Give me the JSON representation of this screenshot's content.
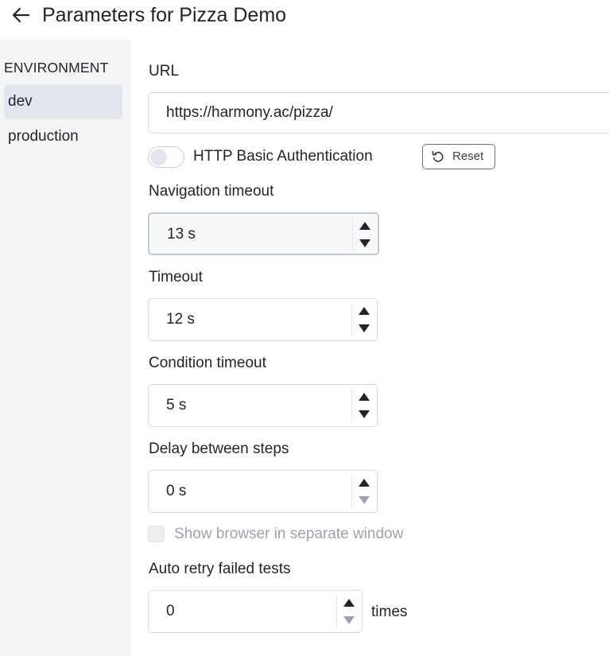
{
  "header": {
    "title": "Parameters for Pizza Demo"
  },
  "sidebar": {
    "heading": "ENVIRONMENT",
    "items": [
      {
        "label": "dev",
        "active": true
      },
      {
        "label": "production",
        "active": false
      }
    ]
  },
  "form": {
    "url": {
      "label": "URL",
      "value": "https://harmony.ac/pizza/"
    },
    "basic_auth": {
      "label": "HTTP Basic Authentication",
      "enabled": false
    },
    "reset_label": "Reset",
    "navigation_timeout": {
      "label": "Navigation timeout",
      "value": "13 s"
    },
    "timeout": {
      "label": "Timeout",
      "value": "12 s"
    },
    "condition_timeout": {
      "label": "Condition timeout",
      "value": "5 s"
    },
    "delay_between_steps": {
      "label": "Delay between steps",
      "value": "0 s"
    },
    "show_browser": {
      "label": "Show browser in separate window",
      "checked": false,
      "disabled": true
    },
    "auto_retry": {
      "label": "Auto retry failed tests",
      "value": "0",
      "suffix": "times"
    }
  },
  "icons": {
    "back": "arrow-left-icon",
    "reset": "undo-icon",
    "increment": "triangle-up-icon",
    "decrement": "triangle-down-icon"
  },
  "colors": {
    "text": "#222428",
    "sidebar_bg": "#f4f5f7",
    "active_item_bg": "#e3e6ec",
    "disabled_text": "#9ea3ab",
    "border": "#d6d9de"
  }
}
